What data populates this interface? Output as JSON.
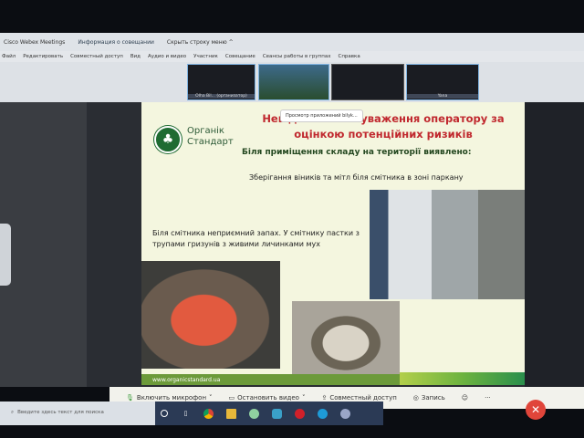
{
  "window": {
    "app_title": "Cisco Webex Meetings",
    "meeting_info": "Информация о совещании",
    "hide_menu": "Скрыть строку меню ^"
  },
  "menu": [
    "Файл",
    "Редактировать",
    "Совместный доступ",
    "Вид",
    "Аудио и видео",
    "Участник",
    "Совещание",
    "Сеансы работы в группах",
    "Справка"
  ],
  "participants": [
    {
      "name": "Olha Bil... (организатор)"
    },
    {
      "name": ""
    },
    {
      "name": ""
    },
    {
      "name": "Yana"
    }
  ],
  "slide": {
    "logo_line1": "Органік",
    "logo_line2": "Стандарт",
    "title": "Невідповідності та зауваження оператору за оцінкою потенційних ризиків",
    "title_visible_1": "Невід",
    "title_visible_2": "уваження оператору за",
    "title_visible_3": "оцінкою потенційних ризиків",
    "tooltip": "Просмотр приложений bilyk...",
    "subtitle": "Біля приміщення складу на території виявлено:",
    "point1": "Зберігання віників та мітл біля смітника в зоні паркану",
    "point2": "Біля смітника неприємний запах. У смітнику пастки з трупами гризунів  з живими личинками мух",
    "footer_url": "www.organicstandard.ua"
  },
  "toolbar": {
    "mic": "Включить микрофон",
    "video": "Остановить видео",
    "share": "Совместный доступ",
    "record": "Запись",
    "more": "···",
    "leave": "✕"
  },
  "taskbar": {
    "search_placeholder": "Введите здесь текст для поиска"
  },
  "colors": {
    "title_red": "#c0282e",
    "brand_green": "#1f6b32",
    "leave_red": "#e0453a"
  }
}
